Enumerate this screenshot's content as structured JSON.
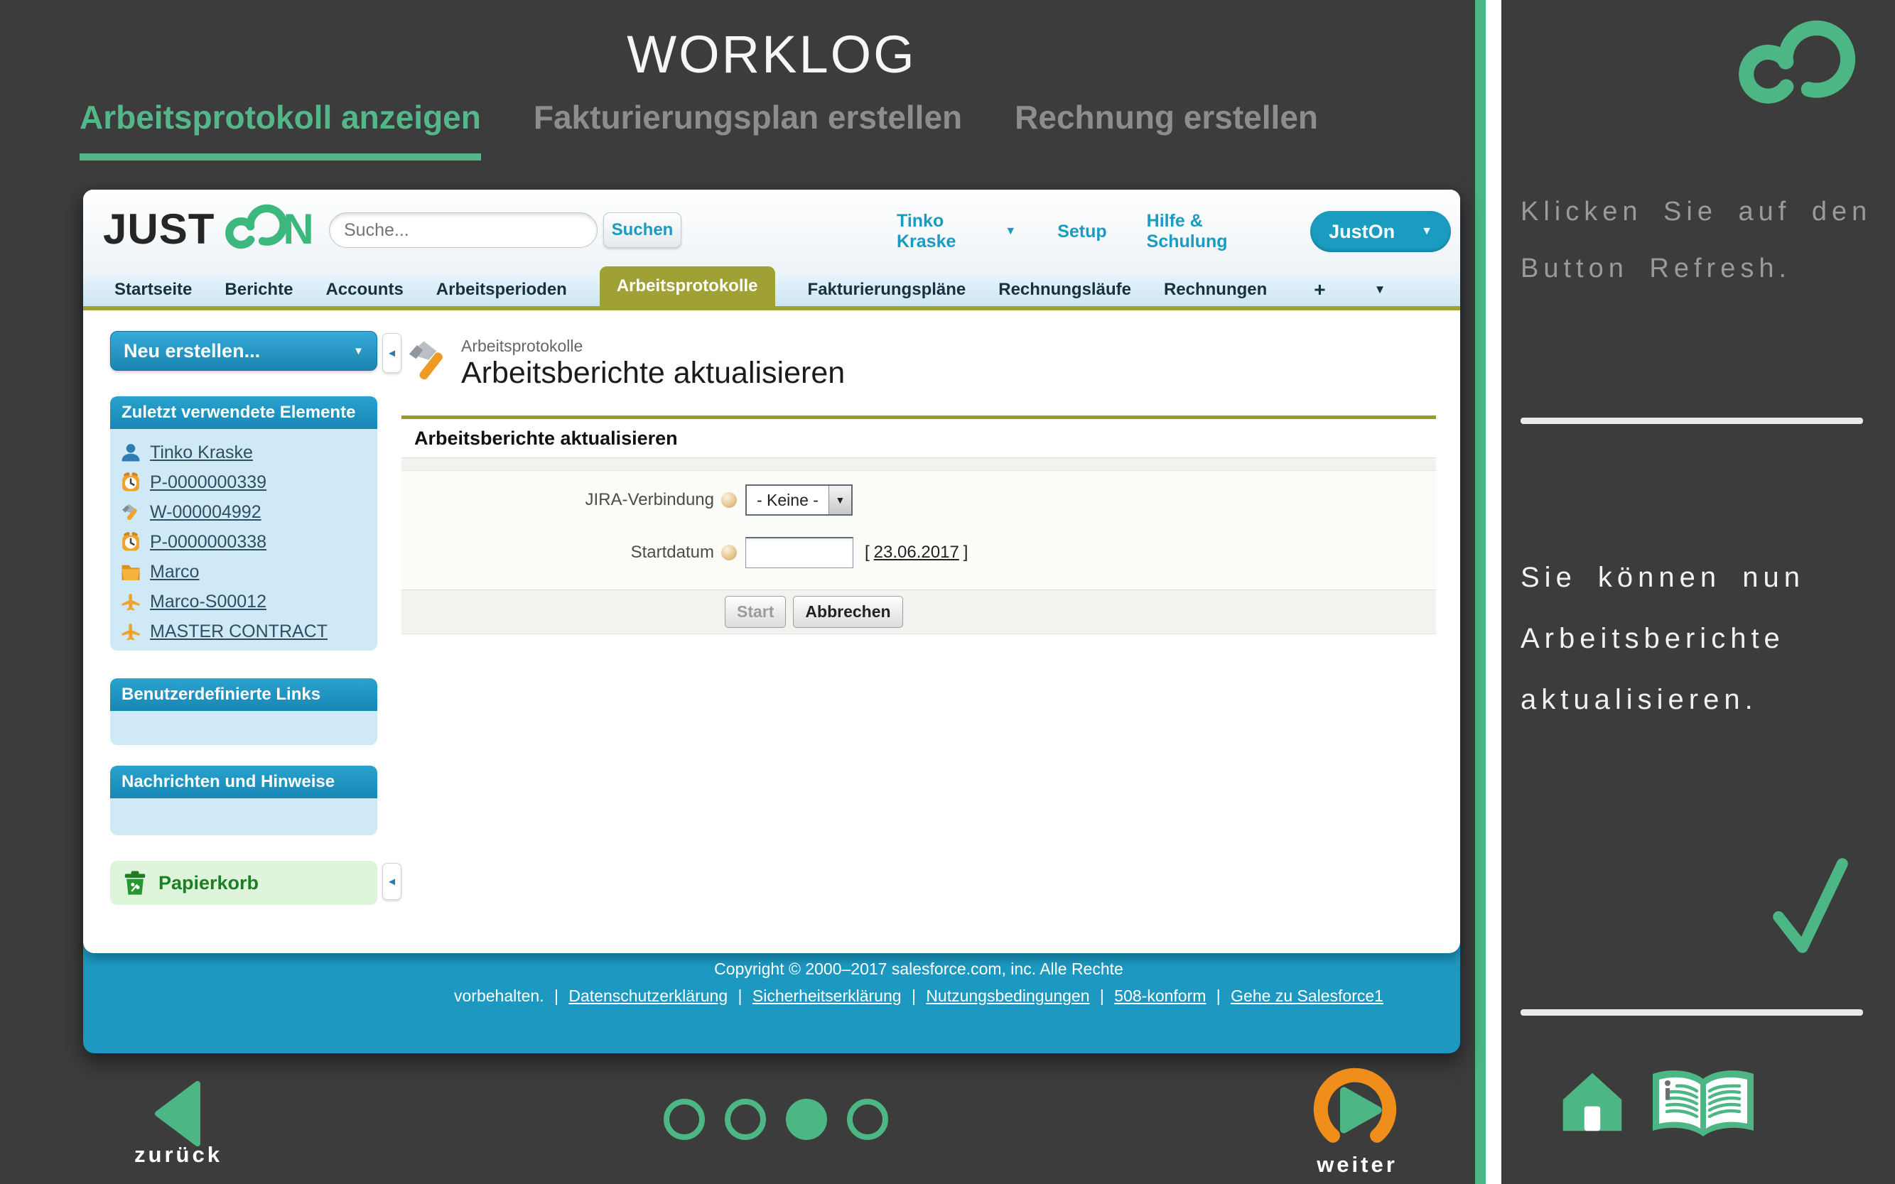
{
  "colors": {
    "accent_green": "#4cb685",
    "orange": "#ef8e1b",
    "salesforce_blue": "#1d99c1",
    "olive": "#a0a134",
    "dark_bg": "#3c3c3c"
  },
  "icons": {
    "caret_down": "▼",
    "caret_left": "◄",
    "plus": "+"
  },
  "header": {
    "title": "WORKLOG",
    "steps": [
      {
        "label": "Arbeitsprotokoll anzeigen",
        "active": true
      },
      {
        "label": "Fakturierungsplan erstellen",
        "active": false
      },
      {
        "label": "Rechnung erstellen",
        "active": false
      }
    ]
  },
  "app": {
    "logo_just": "JUST",
    "logo_n": "N",
    "search": {
      "placeholder": "Suche...",
      "button": "Suchen"
    },
    "user_menu": "Tinko Kraske",
    "setup": "Setup",
    "help": "Hilfe & Schulung",
    "app_selector": "JustOn",
    "nav_tabs": [
      {
        "label": "Startseite",
        "active": false
      },
      {
        "label": "Berichte",
        "active": false
      },
      {
        "label": "Accounts",
        "active": false
      },
      {
        "label": "Arbeitsperioden",
        "active": false
      },
      {
        "label": "Arbeitsprotokolle",
        "active": true
      },
      {
        "label": "Fakturierungspläne",
        "active": false
      },
      {
        "label": "Rechnungsläufe",
        "active": false
      },
      {
        "label": "Rechnungen",
        "active": false
      }
    ],
    "sidebar": {
      "create_button": "Neu erstellen...",
      "recent_title": "Zuletzt verwendete Elemente",
      "recent_items": [
        {
          "label": "Tinko Kraske",
          "icon": "user-icon"
        },
        {
          "label": "P-0000000339",
          "icon": "clock-icon"
        },
        {
          "label": "W-000004992",
          "icon": "hammer-icon"
        },
        {
          "label": "P-0000000338",
          "icon": "clock-icon"
        },
        {
          "label": "Marco",
          "icon": "folder-icon"
        },
        {
          "label": "Marco-S00012",
          "icon": "plane-icon"
        },
        {
          "label": "MASTER CONTRACT",
          "icon": "plane-icon"
        }
      ],
      "custom_links_title": "Benutzerdefinierte Links",
      "messages_title": "Nachrichten und Hinweise",
      "recycle_bin": "Papierkorb"
    },
    "main": {
      "breadcrumb": "Arbeitsprotokolle",
      "page_title": "Arbeitsberichte aktualisieren",
      "section_title": "Arbeitsberichte aktualisieren",
      "jira_label": "JIRA-Verbindung",
      "jira_value": "- Keine -",
      "start_label": "Startdatum",
      "start_value": "",
      "date_open": "[",
      "date_link": "23.06.2017",
      "date_close": "]",
      "start_button": "Start",
      "cancel_button": "Abbrechen"
    },
    "footer": {
      "line1": "Copyright © 2000–2017 salesforce.com, inc. Alle Rechte",
      "line2_prefix": "vorbehalten.",
      "separator": "|",
      "links": [
        "Datenschutzerklärung",
        "Sicherheitserklärung",
        "Nutzungsbedingungen",
        "508-konform",
        "Gehe zu Salesforce1"
      ]
    }
  },
  "instructions": {
    "note1": "Klicken Sie auf den Button Refresh.",
    "note2": "Sie können nun Arbeitsberichte aktualisieren."
  },
  "pager": {
    "back": "zurück",
    "next": "weiter",
    "dot_count": 4,
    "active_dot": 3
  }
}
